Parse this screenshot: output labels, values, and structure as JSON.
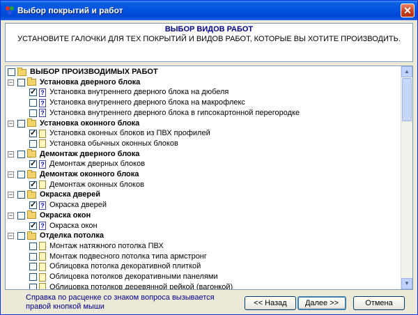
{
  "window": {
    "title": "Выбор покрытий и работ",
    "close_glyph": "✕"
  },
  "info": {
    "title": "ВЫБОР  ВИДОВ РАБОТ",
    "text": "УСТАНОВИТЕ ГАЛОЧКИ ДЛЯ ТЕХ ПОКРЫТИЙ И ВИДОВ РАБОТ, КОТОРЫЕ ВЫ ХОТИТЕ ПРОИЗВОДИТЬ."
  },
  "tree": {
    "root": "ВЫБОР ПРОИЗВОДИМЫХ РАБОТ",
    "groups": [
      {
        "label": "Установка дверного блока",
        "items": [
          {
            "label": "Установка внутреннего дверного блока на дюбеля",
            "checked": true,
            "icon": "question"
          },
          {
            "label": "Установка внутреннего дверного блока на макрофлекс",
            "checked": false,
            "icon": "question"
          },
          {
            "label": "Установка внутреннего дверного блока в гипсокартонной перегородке",
            "checked": false,
            "icon": "question"
          }
        ]
      },
      {
        "label": "Установка оконного блока",
        "items": [
          {
            "label": "Установка оконных блоков из ПВХ профилей",
            "checked": true,
            "icon": "doc"
          },
          {
            "label": "Установка обычных оконных блоков",
            "checked": false,
            "icon": "doc"
          }
        ]
      },
      {
        "label": "Демонтаж дверного блока",
        "items": [
          {
            "label": "Демонтаж дверных блоков",
            "checked": true,
            "icon": "question"
          }
        ]
      },
      {
        "label": "Демонтаж оконного блока",
        "items": [
          {
            "label": "Демонтаж оконных блоков",
            "checked": true,
            "icon": "doc"
          }
        ]
      },
      {
        "label": "Окраска дверей",
        "items": [
          {
            "label": "Окраска дверей",
            "checked": true,
            "icon": "question"
          }
        ]
      },
      {
        "label": "Окраска окон",
        "items": [
          {
            "label": "Окраска окон",
            "checked": true,
            "icon": "question"
          }
        ]
      },
      {
        "label": "Отделка потолка",
        "items": [
          {
            "label": "Монтаж натяжного потолка ПВХ",
            "checked": false,
            "icon": "doc"
          },
          {
            "label": "Монтаж подвесного  потолка типа армстронг",
            "checked": false,
            "icon": "doc"
          },
          {
            "label": "Облицовка потолка декоративной плиткой",
            "checked": false,
            "icon": "doc"
          },
          {
            "label": "Облицовка потолков декоративными панелями",
            "checked": false,
            "icon": "doc"
          },
          {
            "label": "Облицовка потолков деревянной рейкой (вагонкой)",
            "checked": false,
            "icon": "doc"
          }
        ]
      }
    ]
  },
  "footer": {
    "hint": "Справка по расценке со знаком вопроса вызывается правой кнопкой мыши",
    "back_label": "<< Назад",
    "next_label": "Далее >>",
    "cancel_label": "Отмена"
  },
  "icons": {
    "question_glyph": "?",
    "minus_glyph": "−",
    "up_glyph": "▲",
    "down_glyph": "▼"
  }
}
